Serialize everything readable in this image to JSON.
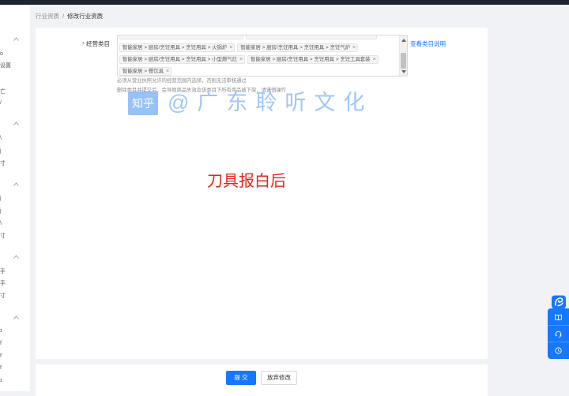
{
  "colors": {
    "topbar": "#1c2430",
    "primary": "#1677ff",
    "required": "#f5222d",
    "note": "#e8231b"
  },
  "sidebar": {
    "fragments": [
      "o",
      "设置",
      "亡",
      "/",
      "\\",
      "j",
      "寸",
      "j",
      "j",
      "\\",
      "寸",
      "手",
      "手",
      "寸",
      "ɪ",
      "f",
      "f",
      "f",
      "ɪ"
    ],
    "group_toggle_icon": "chevron-up-icon"
  },
  "breadcrumb": {
    "parent": "行业资质",
    "separator": "/",
    "current": "修改行业资质"
  },
  "form": {
    "required_mark": "*",
    "category_label": "经营类目",
    "tag_close": "×",
    "tags": [
      {
        "label": "智能家居 > 厨房/烹饪用具 > 烹饪用具 > 火锅炉"
      },
      {
        "label": "智能家居 > 厨房/烹饪用具 > 烹饪用具 > 烹饪气炉"
      },
      {
        "label": "智能家居 > 厨房/烹饪用具 > 烹饪用具 > 小型燃气灶"
      },
      {
        "label": "智能家居 > 厨房/烹饪用具 > 烹饪用具 > 烹饪工具套装"
      },
      {
        "label": "智能家居 > 餐饮具"
      }
    ],
    "help_link": "查看类目说明",
    "hint_1": "必须从营业执照允许的经营范围内选择，否则无法审核通过",
    "hint_2": "删除类目并提交后，会导致商品失效及该类目下所有商品被下架，请谨慎操作"
  },
  "watermark": {
    "logo": "知乎",
    "text": "@广东聆听文化"
  },
  "note": "刀具报白后",
  "actions": {
    "submit": "提 交",
    "discard": "放弃修改"
  },
  "floating_tools": {
    "icons": [
      "brand-logo-icon",
      "book-icon",
      "headset-icon",
      "clock-icon"
    ]
  }
}
